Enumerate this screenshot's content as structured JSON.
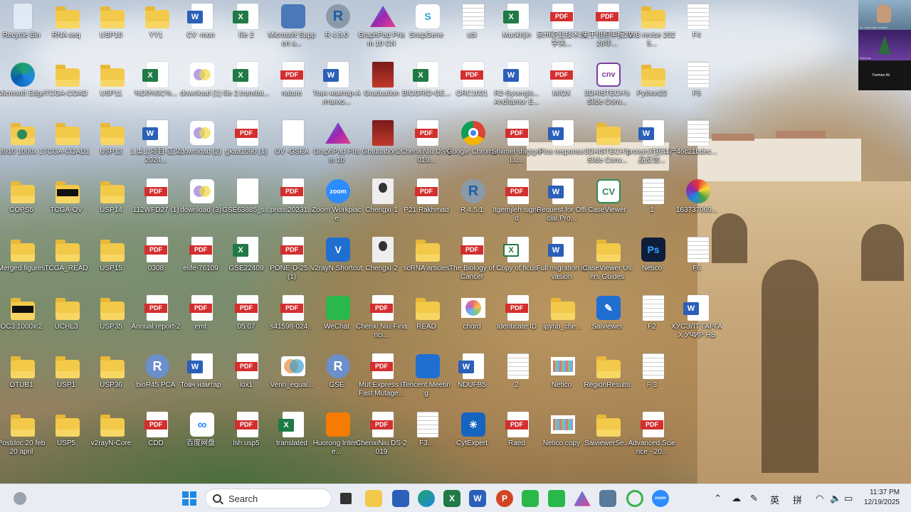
{
  "desktop_icons": [
    {
      "label": "Recycle Bin",
      "type": "recycle",
      "col": 0,
      "row": 0
    },
    {
      "label": "RNA seq",
      "type": "folder",
      "col": 1,
      "row": 0
    },
    {
      "label": "USP10",
      "type": "folder",
      "col": 2,
      "row": 0
    },
    {
      "label": "YY1",
      "type": "folder",
      "col": 3,
      "row": 0
    },
    {
      "label": "CV -mon",
      "type": "word",
      "col": 4,
      "row": 0
    },
    {
      "label": "file 2",
      "type": "excel",
      "col": 5,
      "row": 0
    },
    {
      "label": "Microsoft Support a...",
      "type": "app-blue",
      "col": 6,
      "row": 0
    },
    {
      "label": "R 4.5.0",
      "type": "r",
      "col": 7,
      "row": 0
    },
    {
      "label": "GraphPad Prism 10 CN",
      "type": "prism",
      "col": 8,
      "row": 0
    },
    {
      "label": "SnapGene",
      "type": "snapgene",
      "col": 9,
      "row": 0
    },
    {
      "label": "ubi",
      "type": "image",
      "col": 10,
      "row": 0
    },
    {
      "label": "Munkhjin",
      "type": "excel",
      "col": 11,
      "row": 0
    },
    {
      "label": "泉州职业技术大学关...",
      "type": "pdf",
      "col": 12,
      "row": 0
    },
    {
      "label": "关于组织申报2026年...",
      "type": "pdf",
      "col": 13,
      "row": 0
    },
    {
      "label": "WB revise 2025...",
      "type": "folder",
      "col": 14,
      "row": 0
    },
    {
      "label": "F4",
      "type": "image",
      "col": 15,
      "row": 0
    },
    {
      "label": "Microsoft Edge",
      "type": "edge",
      "col": 0,
      "row": 1
    },
    {
      "label": "TCGA-COAD",
      "type": "folder",
      "col": 1,
      "row": 1
    },
    {
      "label": "USP11",
      "type": "folder",
      "col": 2,
      "row": 1
    },
    {
      "label": "%D0%9C%...",
      "type": "excel",
      "col": 3,
      "row": 1
    },
    {
      "label": "download (1)",
      "type": "venn",
      "col": 4,
      "row": 1
    },
    {
      "label": "file 2.translat...",
      "type": "excel",
      "col": 5,
      "row": 1
    },
    {
      "label": "nature",
      "type": "pdf",
      "col": 6,
      "row": 1
    },
    {
      "label": "Товч намтар-Алтанхэ...",
      "type": "word",
      "col": 7,
      "row": 1
    },
    {
      "label": "Graduation",
      "type": "photo",
      "col": 8,
      "row": 1
    },
    {
      "label": "BIOGRID-GE...",
      "type": "excel",
      "col": 9,
      "row": 1
    },
    {
      "label": "ORC1021",
      "type": "pdf",
      "col": 10,
      "row": 1
    },
    {
      "label": "R2-Synergis... Anditamor E...",
      "type": "word",
      "col": 11,
      "row": 1
    },
    {
      "label": "MIOX",
      "type": "pdf",
      "col": 12,
      "row": 1
    },
    {
      "label": "3DHISTECH's Slide Conv...",
      "type": "cnv",
      "col": 13,
      "row": 1
    },
    {
      "label": "Python22",
      "type": "folder",
      "col": 14,
      "row": 1
    },
    {
      "label": "F5",
      "type": "image",
      "col": 15,
      "row": 1
    },
    {
      "label": "8910 1000x 1",
      "type": "folder-green",
      "col": 0,
      "row": 2
    },
    {
      "label": "TCGA-COAD1",
      "type": "folder",
      "col": 1,
      "row": 2
    },
    {
      "label": "USP13",
      "type": "folder",
      "col": 2,
      "row": 2
    },
    {
      "label": "1.重上项目-正文2024...",
      "type": "word",
      "col": 3,
      "row": 2
    },
    {
      "label": "download (2)",
      "type": "venn",
      "col": 4,
      "row": 2
    },
    {
      "label": "gkaa1090 (1)",
      "type": "pdf",
      "col": 5,
      "row": 2
    },
    {
      "label": "OV -GSEA",
      "type": "doc",
      "col": 6,
      "row": 2
    },
    {
      "label": "GraphPad Prism 10",
      "type": "prism",
      "col": 7,
      "row": 2
    },
    {
      "label": "Graduation2",
      "type": "photo",
      "col": 8,
      "row": 2
    },
    {
      "label": "ChenxiNiu DS-2019...",
      "type": "pdf",
      "col": 9,
      "row": 2
    },
    {
      "label": "Google Chrome",
      "type": "chrome",
      "col": 10,
      "row": 2
    },
    {
      "label": "Shilmel shigtgel LL...",
      "type": "pdf",
      "col": 11,
      "row": 2
    },
    {
      "label": "Plos response",
      "type": "word",
      "col": 12,
      "row": 2
    },
    {
      "label": "3DHISTECH's Slide Conv...",
      "type": "folder",
      "col": 13,
      "row": 2
    },
    {
      "label": "protein对抗体产品反馈...",
      "type": "word",
      "col": 14,
      "row": 2
    },
    {
      "label": "46c21bdec...",
      "type": "image",
      "col": 15,
      "row": 2
    },
    {
      "label": "COPS5",
      "type": "folder",
      "col": 0,
      "row": 3
    },
    {
      "label": "TCGA-OV",
      "type": "folder-dark",
      "col": 1,
      "row": 3
    },
    {
      "label": "USP14",
      "type": "folder",
      "col": 2,
      "row": 3
    },
    {
      "label": "112WFD27 (1)",
      "type": "pdf",
      "col": 3,
      "row": 3
    },
    {
      "label": "download (3)",
      "type": "venn",
      "col": 4,
      "row": 3
    },
    {
      "label": "GSE63885_s...",
      "type": "doc",
      "col": 5,
      "row": 3
    },
    {
      "label": "pnas.20231...",
      "type": "pdf",
      "col": 6,
      "row": 3
    },
    {
      "label": "Zoom Workplace",
      "type": "zoom",
      "col": 7,
      "row": 3
    },
    {
      "label": "Chengxi-1",
      "type": "photo-person",
      "col": 8,
      "row": 3
    },
    {
      "label": "P21 Rakhmad",
      "type": "pdf",
      "col": 9,
      "row": 3
    },
    {
      "label": "R 4.5.1",
      "type": "r",
      "col": 10,
      "row": 3
    },
    {
      "label": "Itgemjleh signed",
      "type": "pdf",
      "col": 11,
      "row": 3
    },
    {
      "label": "Request for Official Pro...",
      "type": "word",
      "col": 12,
      "row": 3
    },
    {
      "label": "CaseViewer",
      "type": "cv",
      "col": 13,
      "row": 3
    },
    {
      "label": "1",
      "type": "image",
      "col": 14,
      "row": 3
    },
    {
      "label": "163737069...",
      "type": "colorball",
      "col": 15,
      "row": 3
    },
    {
      "label": "Merged figures",
      "type": "folder",
      "col": 0,
      "row": 4
    },
    {
      "label": "TCGA_READ",
      "type": "folder",
      "col": 1,
      "row": 4
    },
    {
      "label": "USP15",
      "type": "folder",
      "col": 2,
      "row": 4
    },
    {
      "label": "0308",
      "type": "pdf",
      "col": 3,
      "row": 4
    },
    {
      "label": "elife-76109",
      "type": "pdf",
      "col": 4,
      "row": 4
    },
    {
      "label": "GSE22409",
      "type": "excel",
      "col": 5,
      "row": 4
    },
    {
      "label": "PONE-D-25... (1)",
      "type": "pdf",
      "col": 6,
      "row": 4
    },
    {
      "label": "v2rayN Shortcut",
      "type": "v2ray",
      "col": 7,
      "row": 4
    },
    {
      "label": "Chengxi-2",
      "type": "photo-person",
      "col": 8,
      "row": 4
    },
    {
      "label": "scRNA articles",
      "type": "folder",
      "col": 9,
      "row": 4
    },
    {
      "label": "The Biology of Cancer",
      "type": "pdf",
      "col": 10,
      "row": 4
    },
    {
      "label": "Copy of ficus",
      "type": "excel-outline",
      "col": 11,
      "row": 4
    },
    {
      "label": "Full migration invasion",
      "type": "word",
      "col": 12,
      "row": 4
    },
    {
      "label": "CaseViewer Users Guides",
      "type": "folder",
      "col": 13,
      "row": 4
    },
    {
      "label": "Netico",
      "type": "ps",
      "col": 14,
      "row": 4
    },
    {
      "label": "F6",
      "type": "image",
      "col": 15,
      "row": 4
    },
    {
      "label": "OC3 1000x 2",
      "type": "folder-dark",
      "col": 0,
      "row": 5
    },
    {
      "label": "UCHL3",
      "type": "folder",
      "col": 1,
      "row": 5
    },
    {
      "label": "USP35",
      "type": "folder",
      "col": 2,
      "row": 5
    },
    {
      "label": "Annual report-2",
      "type": "pdf",
      "col": 3,
      "row": 5
    },
    {
      "label": "emt",
      "type": "pdf",
      "col": 4,
      "row": 5
    },
    {
      "label": "05.07",
      "type": "pdf",
      "col": 5,
      "row": 5
    },
    {
      "label": "s41598-024...",
      "type": "pdf",
      "col": 6,
      "row": 5
    },
    {
      "label": "WeChat",
      "type": "wechat",
      "col": 7,
      "row": 5
    },
    {
      "label": "Chenxi Niu-Financi...",
      "type": "pdf",
      "col": 8,
      "row": 5
    },
    {
      "label": "READ",
      "type": "folder",
      "col": 9,
      "row": 5
    },
    {
      "label": "chord",
      "type": "chord",
      "col": 10,
      "row": 5
    },
    {
      "label": "Identicate ID",
      "type": "pdf",
      "col": 11,
      "row": 5
    },
    {
      "label": ".ipynb_che...",
      "type": "folder",
      "col": 12,
      "row": 5
    },
    {
      "label": "Saiviewer",
      "type": "saiviewer",
      "col": 13,
      "row": 5
    },
    {
      "label": "F2",
      "type": "image",
      "col": 14,
      "row": 5
    },
    {
      "label": "ХУСЭЛТ ГАРГАХ УЧИР НЬ",
      "type": "word",
      "col": 15,
      "row": 5
    },
    {
      "label": "OTUB1",
      "type": "folder",
      "col": 0,
      "row": 6
    },
    {
      "label": "USP1",
      "type": "folder",
      "col": 1,
      "row": 6
    },
    {
      "label": "USP36",
      "type": "folder",
      "col": 2,
      "row": 6
    },
    {
      "label": "bioR45 PCA",
      "type": "r-round",
      "col": 3,
      "row": 6
    },
    {
      "label": "Товч намтар",
      "type": "word",
      "col": 4,
      "row": 6
    },
    {
      "label": "lox1",
      "type": "pdf",
      "col": 5,
      "row": 6
    },
    {
      "label": "Venn_equal...",
      "type": "venn2",
      "col": 6,
      "row": 6
    },
    {
      "label": "GSE",
      "type": "r-round",
      "col": 7,
      "row": 6
    },
    {
      "label": "Mut Express II Fast Mutage...",
      "type": "pdf",
      "col": 8,
      "row": 6
    },
    {
      "label": "Tencent Meeting",
      "type": "tencent",
      "col": 9,
      "row": 6
    },
    {
      "label": "NDUFB5",
      "type": "word",
      "col": 10,
      "row": 6
    },
    {
      "label": "2",
      "type": "image",
      "col": 11,
      "row": 6
    },
    {
      "label": "Netico",
      "type": "netico",
      "col": 12,
      "row": 6
    },
    {
      "label": "RegionResults",
      "type": "folder",
      "col": 13,
      "row": 6
    },
    {
      "label": "F 3",
      "type": "image",
      "col": 14,
      "row": 6
    },
    {
      "label": "Postdoc 20 feb 20 april",
      "type": "folder",
      "col": 0,
      "row": 7
    },
    {
      "label": "USP5",
      "type": "folder",
      "col": 1,
      "row": 7
    },
    {
      "label": "v2rayN-Core",
      "type": "folder",
      "col": 2,
      "row": 7
    },
    {
      "label": "CDD",
      "type": "pdf",
      "col": 3,
      "row": 7
    },
    {
      "label": "百度网盘",
      "type": "baidu",
      "col": 4,
      "row": 7
    },
    {
      "label": "lsh usp5",
      "type": "pdf",
      "col": 5,
      "row": 7
    },
    {
      "label": "translated",
      "type": "excel",
      "col": 6,
      "row": 7
    },
    {
      "label": "Huorong Interne...",
      "type": "huorong",
      "col": 7,
      "row": 7
    },
    {
      "label": "ChenxiNiu DS-2019",
      "type": "pdf",
      "col": 8,
      "row": 7
    },
    {
      "label": "F3...",
      "type": "image",
      "col": 9,
      "row": 7
    },
    {
      "label": "CytExpert",
      "type": "cyt",
      "col": 10,
      "row": 7
    },
    {
      "label": "Raed",
      "type": "pdf",
      "col": 11,
      "row": 7
    },
    {
      "label": "Netico copy",
      "type": "netico",
      "col": 12,
      "row": 7
    },
    {
      "label": "SaiviewerSe...",
      "type": "folder",
      "col": 13,
      "row": 7
    },
    {
      "label": "Advanced Science - 20...",
      "type": "pdf",
      "col": 14,
      "row": 7
    }
  ],
  "taskbar": {
    "search_placeholder": "Search",
    "ime_lang": "英",
    "ime_mode": "拼",
    "time": "11:37 PM",
    "date": "12/19/2025",
    "apps": [
      "weather",
      "windows-start",
      "search",
      "task-view",
      "file-explorer",
      "store",
      "edge",
      "excel",
      "word",
      "powerpoint",
      "wechat",
      "messages",
      "prism",
      "photos",
      "360",
      "zoom"
    ]
  },
  "thumbnails": [
    {
      "name": "Dr. Syed Atiq Hussain"
    },
    {
      "name": "Nanchao"
    },
    {
      "name": "Farman Ali"
    }
  ],
  "colors": {
    "folder": "#f3c949",
    "word": "#2b5fb8",
    "excel": "#1f7a45",
    "pdf": "#d32f2f",
    "taskbar": "#e9edf3"
  }
}
